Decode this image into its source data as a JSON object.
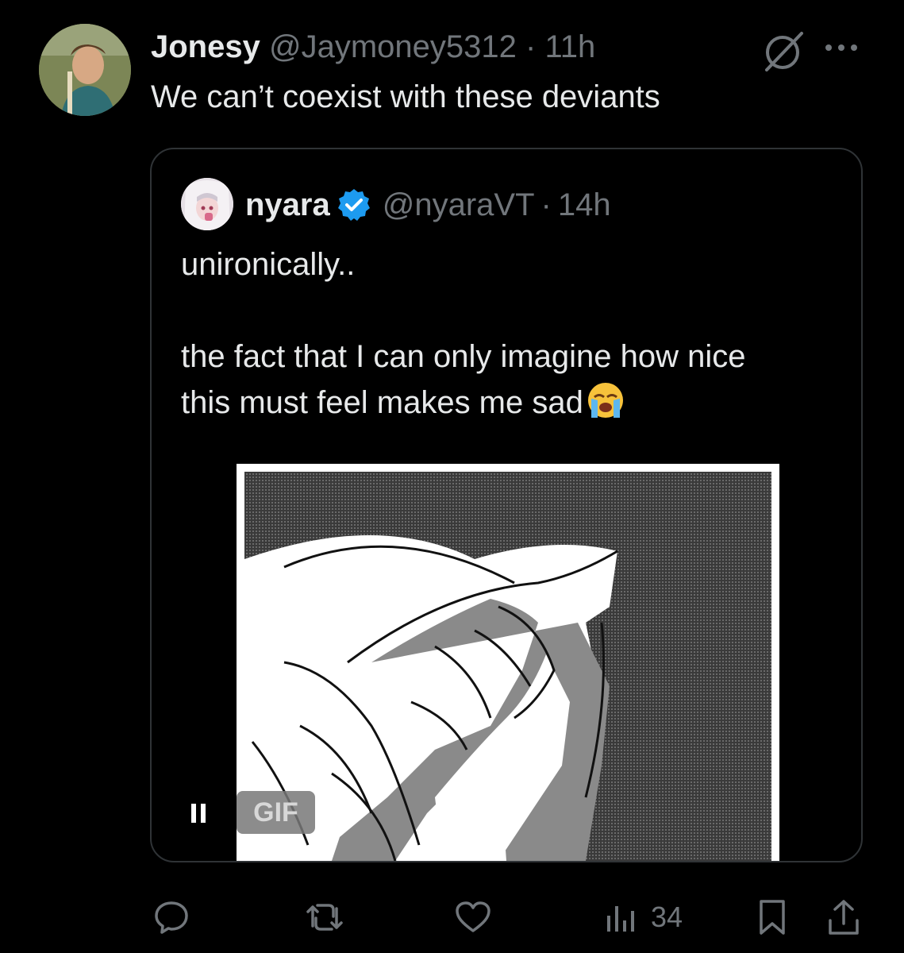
{
  "tweet": {
    "author": {
      "display_name": "Jonesy",
      "handle": "@Jaymoney5312",
      "separator": "·",
      "time": "11h",
      "avatar_icon": "user-avatar"
    },
    "text": "We can’t coexist with these deviants",
    "grok_icon": "slashed-circle-icon",
    "more_icon": "ellipsis-icon"
  },
  "quote": {
    "author": {
      "display_name": "nyara",
      "verified_icon": "verified-badge-icon",
      "handle": "@nyaraVT",
      "separator": "·",
      "time": "14h",
      "avatar_icon": "user-avatar"
    },
    "text_line1": "unironically..",
    "text_line2": "the fact that I can only imagine how nice",
    "text_line3": "this must feel makes me sad",
    "emoji": "loudly-crying-face",
    "media": {
      "type": "gif",
      "badge": "GIF",
      "pause_label": "II"
    }
  },
  "actions": {
    "reply_icon": "reply-icon",
    "repost_icon": "repost-icon",
    "like_icon": "heart-icon",
    "views_icon": "views-icon",
    "views_count": "34",
    "bookmark_icon": "bookmark-icon",
    "share_icon": "share-icon"
  },
  "colors": {
    "background": "#000000",
    "text_primary": "#e7e9ea",
    "text_secondary": "#71767b",
    "border": "#2f3336",
    "verified_blue": "#1d9bf0"
  }
}
